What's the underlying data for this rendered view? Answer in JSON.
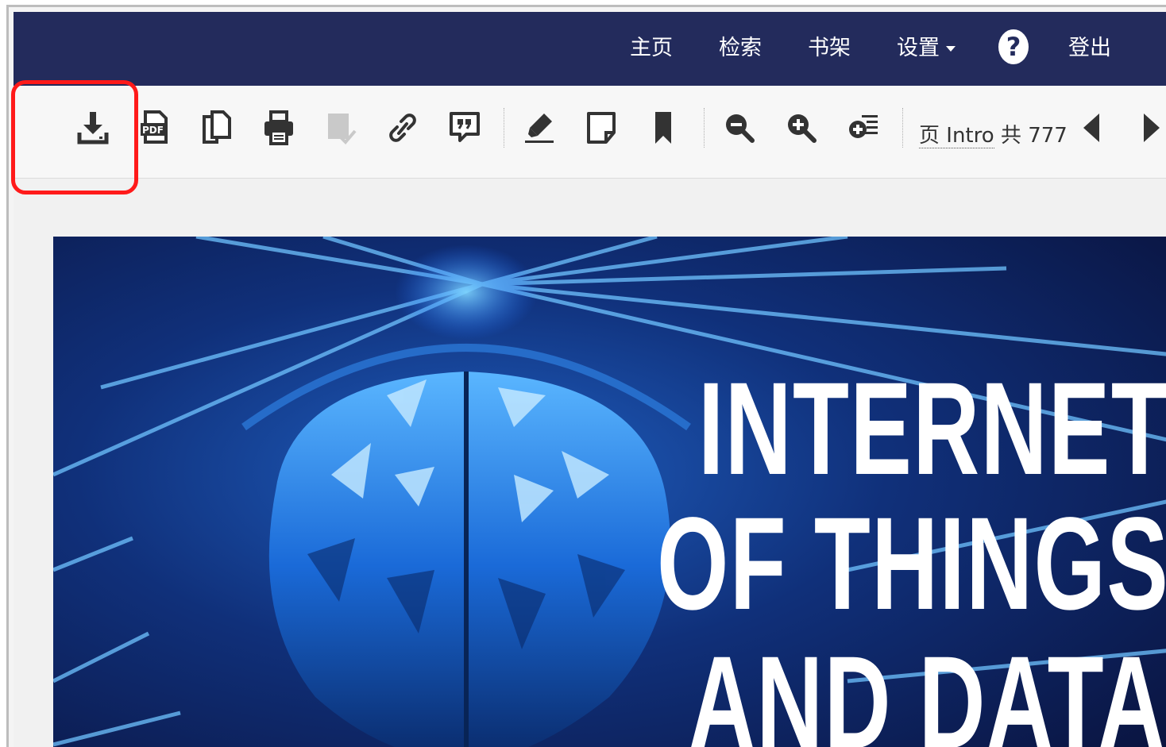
{
  "topbar": {
    "nav": [
      {
        "label": "主页"
      },
      {
        "label": "检索"
      },
      {
        "label": "书架"
      },
      {
        "label": "设置"
      },
      {
        "label": "登出"
      }
    ],
    "help_icon": "question-circle-icon",
    "bg_color": "#232b5c"
  },
  "toolbar": {
    "buttons": [
      {
        "name": "download",
        "icon": "download-icon"
      },
      {
        "name": "pdf",
        "icon": "pdf-icon"
      },
      {
        "name": "copy",
        "icon": "copy-icon"
      },
      {
        "name": "print",
        "icon": "print-icon"
      },
      {
        "name": "check-document",
        "icon": "document-check-icon"
      },
      {
        "name": "link",
        "icon": "link-icon"
      },
      {
        "name": "quote",
        "icon": "quote-icon"
      },
      {
        "name": "highlight",
        "icon": "highlighter-icon"
      },
      {
        "name": "note",
        "icon": "note-icon"
      },
      {
        "name": "bookmark",
        "icon": "bookmark-icon"
      },
      {
        "name": "zoom-out",
        "icon": "zoom-out-icon"
      },
      {
        "name": "zoom-in",
        "icon": "zoom-in-icon"
      },
      {
        "name": "fit-page",
        "icon": "fit-page-icon"
      }
    ],
    "page": {
      "label": "页",
      "current": "Intro",
      "total_label": "共",
      "total": "777"
    },
    "highlight_color": "#ff1a1a"
  },
  "cover": {
    "title_lines": [
      "INTERNET",
      "OF THINGS",
      "AND DATA"
    ],
    "bg_color": "#0d1a4a"
  }
}
